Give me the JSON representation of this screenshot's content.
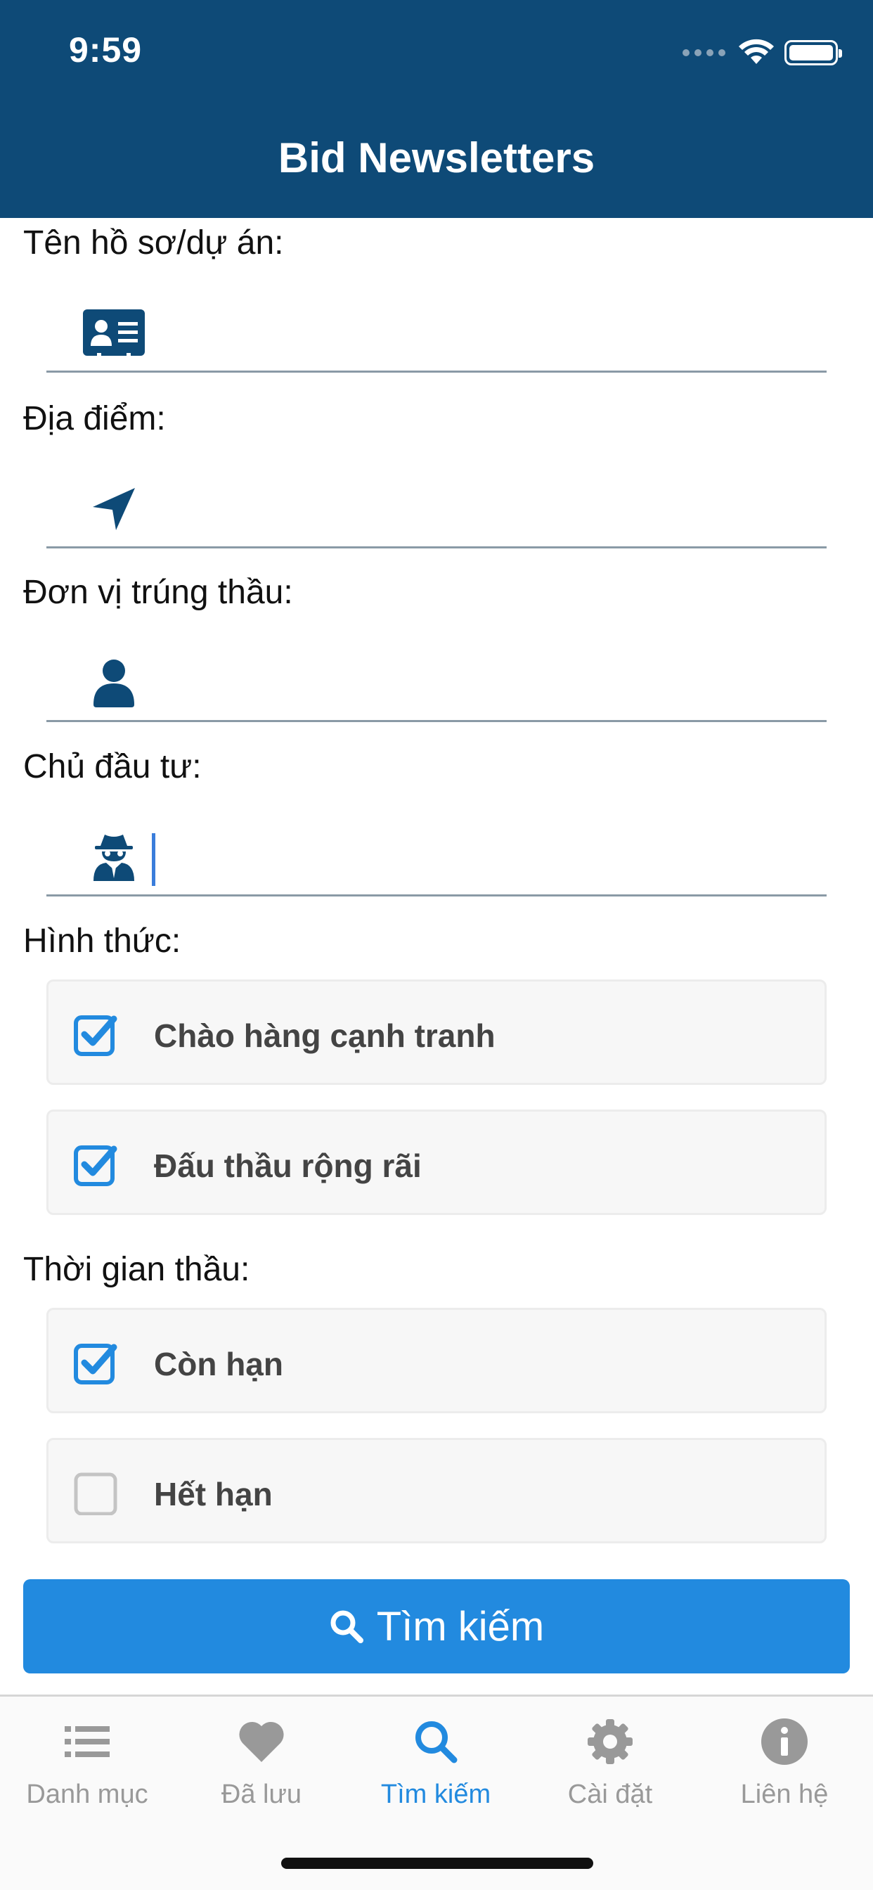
{
  "status_bar": {
    "time": "9:59"
  },
  "header": {
    "title": "Bid Newsletters"
  },
  "form": {
    "project_name": {
      "label": "Tên hồ sơ/dự án:",
      "value": "",
      "icon": "id-card-icon"
    },
    "location": {
      "label": "Địa điểm:",
      "value": "",
      "icon": "location-arrow-icon"
    },
    "winner": {
      "label": "Đơn vị trúng thầu:",
      "value": "",
      "icon": "user-icon"
    },
    "investor": {
      "label": "Chủ đầu tư:",
      "value": "",
      "icon": "user-secret-icon"
    },
    "form_type": {
      "label": "Hình thức:",
      "options": [
        {
          "label": "Chào hàng cạnh tranh",
          "checked": true
        },
        {
          "label": "Đấu thầu rộng rãi",
          "checked": true
        }
      ]
    },
    "bid_time": {
      "label": "Thời gian thầu:",
      "options": [
        {
          "label": "Còn hạn",
          "checked": true
        },
        {
          "label": "Hết hạn",
          "checked": false
        }
      ]
    },
    "search_button": {
      "label": "Tìm kiếm",
      "icon": "search-icon"
    }
  },
  "colors": {
    "header_bg": "#0e4a77",
    "accent": "#228adf",
    "icon": "#0e4a77",
    "tab_inactive": "#999999"
  },
  "tabbar": {
    "active_index": 2,
    "tabs": [
      {
        "label": "Danh mục",
        "icon": "list-icon"
      },
      {
        "label": "Đã lưu",
        "icon": "heart-icon"
      },
      {
        "label": "Tìm kiếm",
        "icon": "search-icon"
      },
      {
        "label": "Cài đặt",
        "icon": "gear-icon"
      },
      {
        "label": "Liên hệ",
        "icon": "info-icon"
      }
    ]
  }
}
